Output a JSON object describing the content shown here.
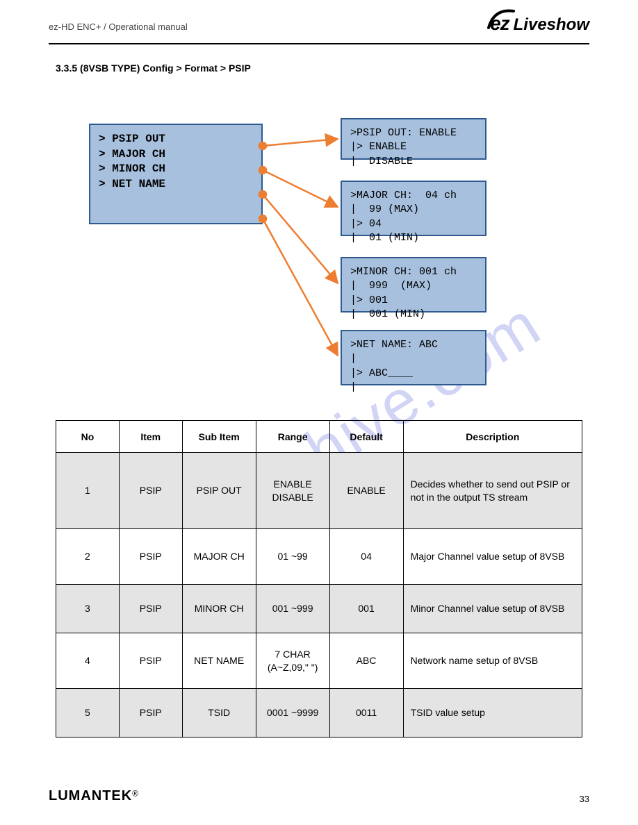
{
  "header": {
    "doc_title": "ez-HD ENC+ / Operational manual",
    "brand_ez": "ez",
    "brand_text": "Liveshow"
  },
  "section": {
    "path": "3.3.5  (8VSB TYPE) Config > Format > PSIP"
  },
  "diagram": {
    "main_menu": "> PSIP OUT\n> MAJOR CH\n> MINOR CH\n> NET NAME",
    "box_psip": ">PSIP OUT: ENABLE\n|> ENABLE\n|  DISABLE",
    "box_major": ">MAJOR CH:  04 ch\n|  99 (MAX)\n|> 04\n|  01 (MIN)",
    "box_minor": ">MINOR CH: 001 ch\n|  999  (MAX)\n|> 001\n|  001 (MIN)",
    "box_net": ">NET NAME: ABC\n| \n|> ABC____\n| "
  },
  "table": {
    "headers": [
      "No",
      "Item",
      "Sub Item",
      "Range",
      "Default",
      "Description"
    ],
    "rows": [
      {
        "no": "1",
        "item": "PSIP",
        "sub": "PSIP OUT",
        "range": "ENABLE\nDISABLE",
        "def": "ENABLE",
        "desc": "Decides whether to send out PSIP or not in the output TS stream"
      },
      {
        "no": "2",
        "item": "PSIP",
        "sub": "MAJOR CH",
        "range": "01\n~99",
        "def": "04",
        "desc": "Major Channel value setup of 8VSB"
      },
      {
        "no": "3",
        "item": "PSIP",
        "sub": "MINOR CH",
        "range": "001\n~999",
        "def": "001",
        "desc": "Minor Channel value setup of 8VSB"
      },
      {
        "no": "4",
        "item": "PSIP",
        "sub": "NET NAME",
        "range": "7 CHAR\n(A~Z,09,\" \")",
        "def": "ABC",
        "desc": "Network name setup of 8VSB"
      },
      {
        "no": "5",
        "item": "PSIP",
        "sub": "TSID",
        "range": "0001\n~9999",
        "def": "0011",
        "desc": "TSID value setup"
      }
    ]
  },
  "footer": {
    "brand": "LUMANTEK",
    "reg": "®",
    "page": "33"
  },
  "watermark": "manualshive.com"
}
